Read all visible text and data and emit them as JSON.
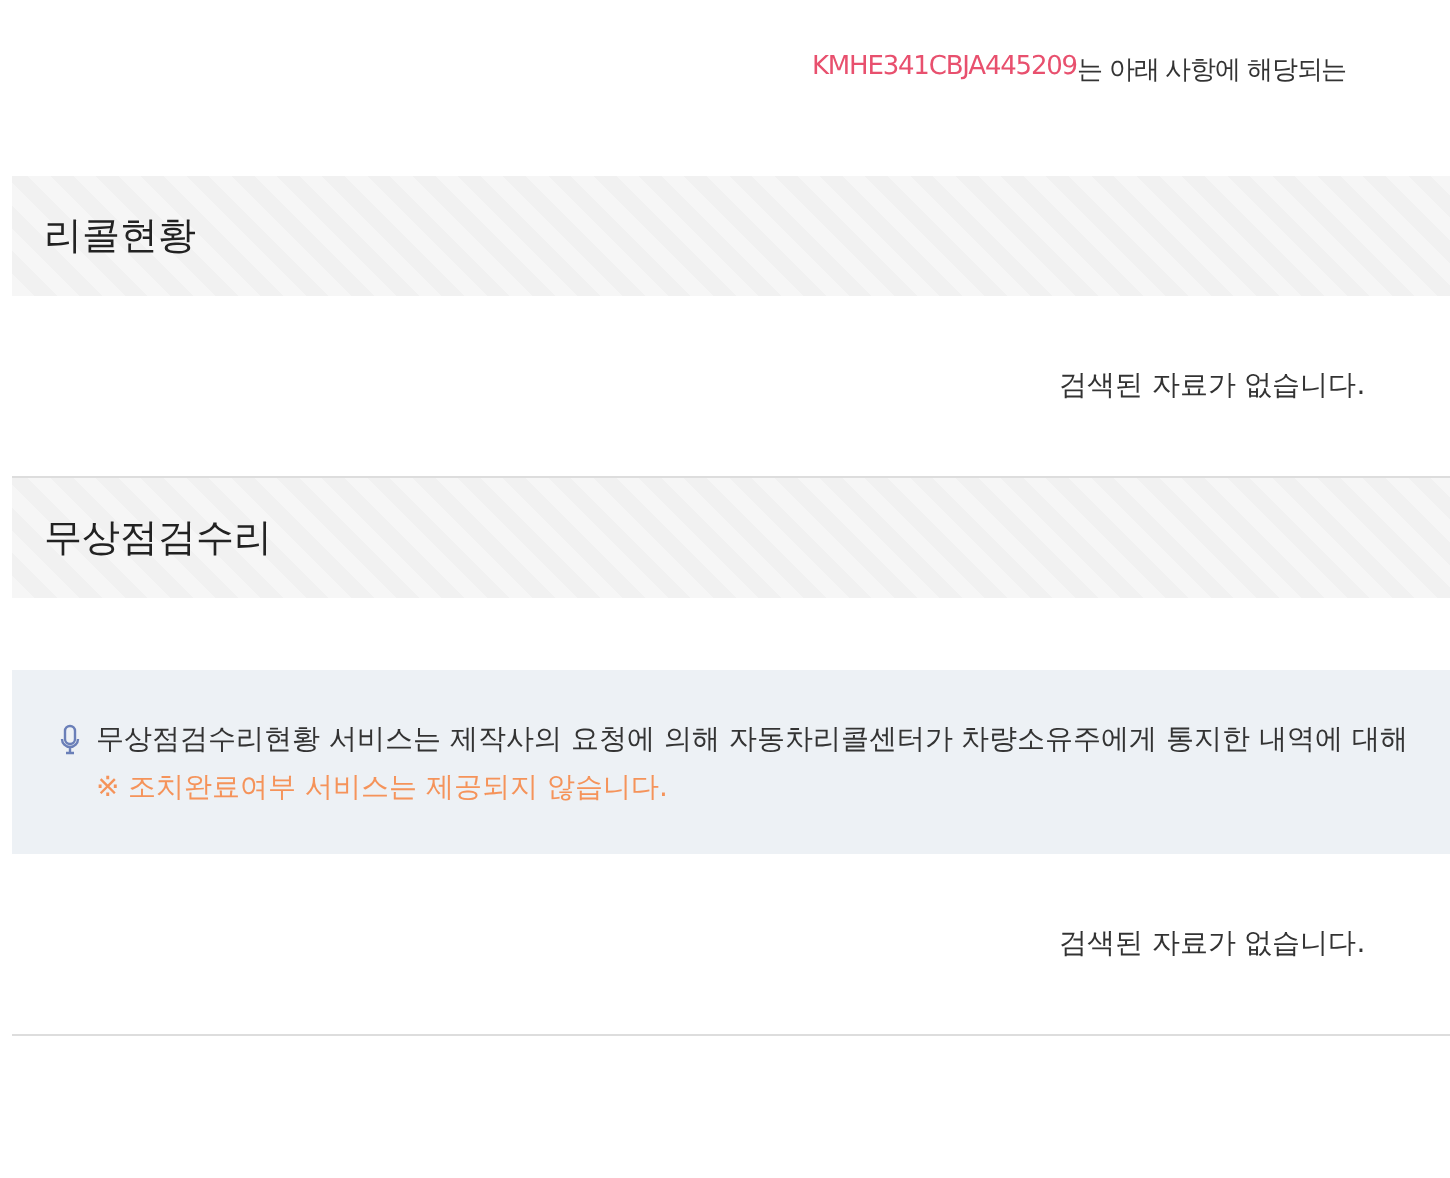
{
  "notice": {
    "vin": "KMHE341CBJA445209",
    "text": "는 아래 사항에 해당되는"
  },
  "sections": [
    {
      "title": "리콜현황",
      "empty_message": "검색된 자료가 없습니다."
    },
    {
      "title": "무상점검수리",
      "info": {
        "text": "무상점검수리현황 서비스는 제작사의 요청에 의해 자동차리콜센터가 차량소유주에게 통지한 내역에 대해",
        "warning": "※ 조치완료여부 서비스는 제공되지 않습니다."
      },
      "empty_message": "검색된 자료가 없습니다."
    }
  ]
}
